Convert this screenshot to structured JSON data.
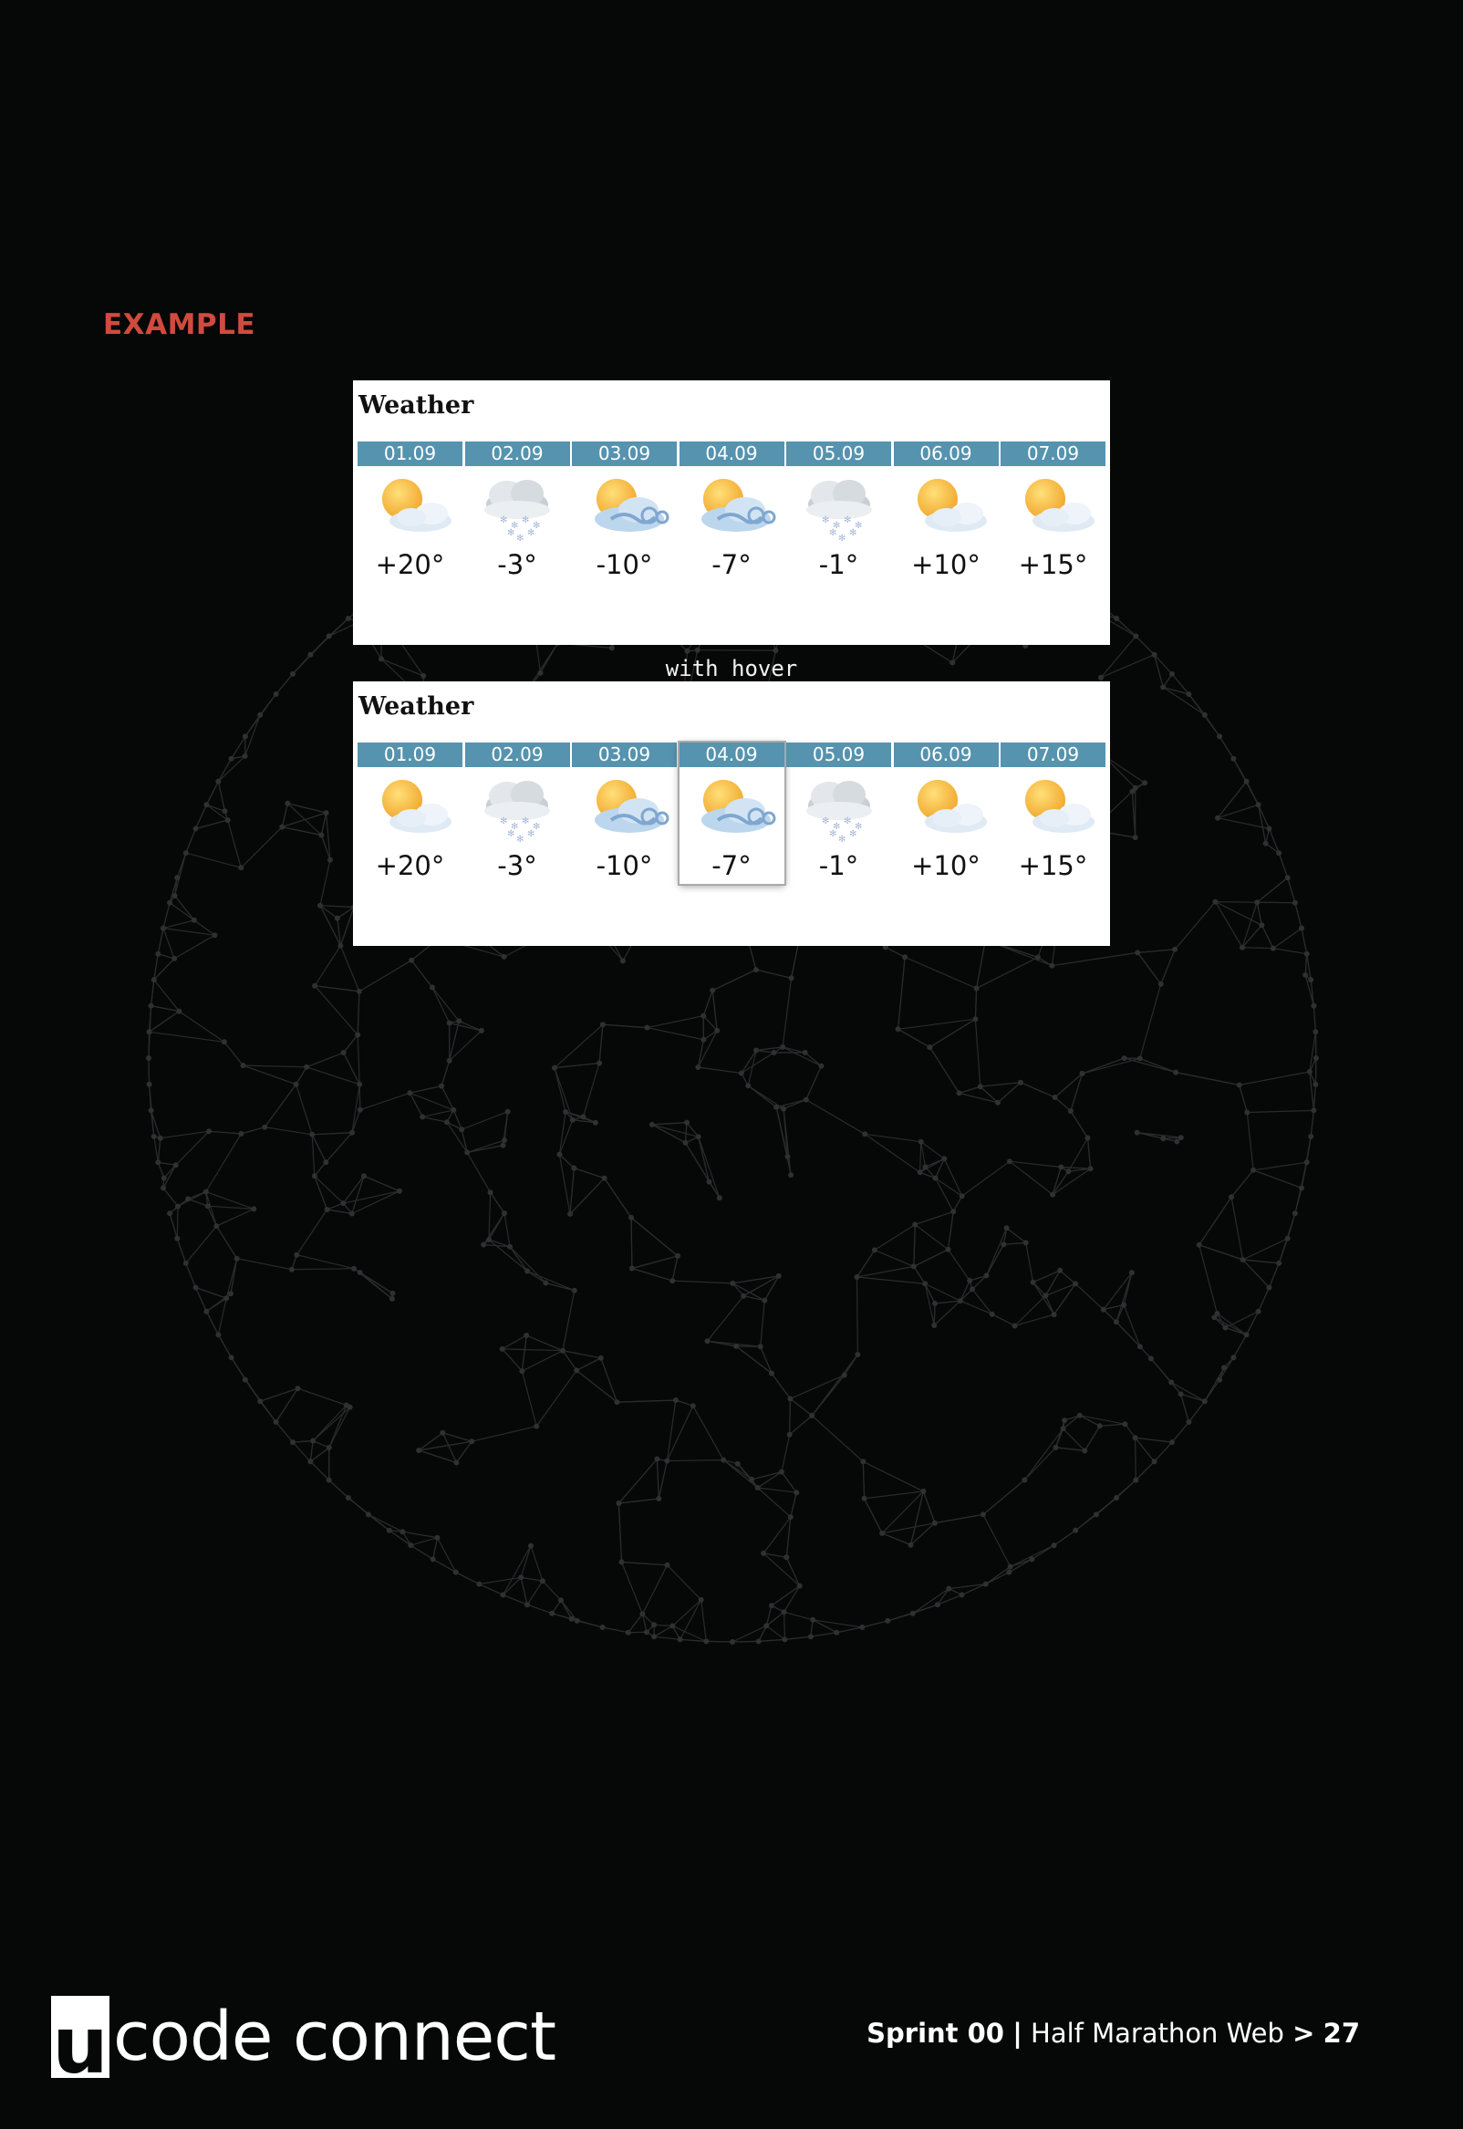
{
  "example_label": "EXAMPLE",
  "caption": "with hover",
  "panels": [
    {
      "title": "Weather",
      "days": [
        {
          "date": "01.09",
          "icon": "sun-cloud-icon",
          "temp": "+20°"
        },
        {
          "date": "02.09",
          "icon": "snow-cloud-icon",
          "temp": "-3°"
        },
        {
          "date": "03.09",
          "icon": "sun-wind-cloud-icon",
          "temp": "-10°"
        },
        {
          "date": "04.09",
          "icon": "sun-wind-cloud-icon",
          "temp": "-7°"
        },
        {
          "date": "05.09",
          "icon": "snow-cloud-icon",
          "temp": "-1°"
        },
        {
          "date": "06.09",
          "icon": "sun-cloud-icon",
          "temp": "+10°"
        },
        {
          "date": "07.09",
          "icon": "sun-cloud-icon",
          "temp": "+15°"
        }
      ]
    },
    {
      "title": "Weather",
      "hovered_day": "04.09",
      "days": [
        {
          "date": "01.09",
          "icon": "sun-cloud-icon",
          "temp": "+20°"
        },
        {
          "date": "02.09",
          "icon": "snow-cloud-icon",
          "temp": "-3°"
        },
        {
          "date": "03.09",
          "icon": "sun-wind-cloud-icon",
          "temp": "-10°"
        },
        {
          "date": "04.09",
          "icon": "sun-wind-cloud-icon",
          "temp": "-7°"
        },
        {
          "date": "05.09",
          "icon": "snow-cloud-icon",
          "temp": "-1°"
        },
        {
          "date": "06.09",
          "icon": "sun-cloud-icon",
          "temp": "+10°"
        },
        {
          "date": "07.09",
          "icon": "sun-cloud-icon",
          "temp": "+15°"
        }
      ]
    }
  ],
  "footer": {
    "logo_letter": "u",
    "logo_text": "code connect",
    "sprint": "Sprint 00",
    "separator": "|",
    "course": "Half Marathon Web",
    "arrow": ">",
    "page": "27"
  },
  "colors": {
    "background": "#060707",
    "accent": "#d04b3e",
    "date_bar": "#5593ae"
  }
}
